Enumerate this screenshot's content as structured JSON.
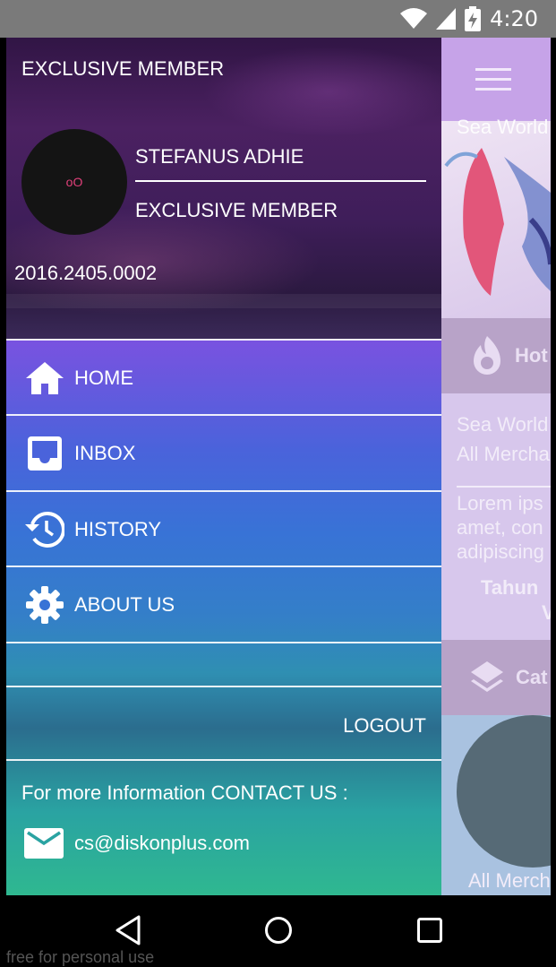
{
  "status_bar": {
    "time": "4:20",
    "icons": [
      "wifi-icon",
      "signal-icon",
      "battery-charging-icon"
    ]
  },
  "background_app": {
    "banner_caption": "Sea World",
    "section_hot": "Hot",
    "card_line1": "Sea World",
    "card_line2": "All Mercha",
    "card_desc1": "Lorem ips",
    "card_desc2": "amet, con",
    "card_desc3": "adipiscing",
    "card_year": "Tahun",
    "card_extra": "V",
    "section_cat": "Cat",
    "footer_text": "All Merch"
  },
  "drawer": {
    "header": {
      "title": "EXCLUSIVE MEMBER",
      "user_name": "STEFANUS ADHIE",
      "user_level": "EXCLUSIVE MEMBER",
      "member_id": "2016.2405.0002",
      "avatar_glyph": "oO"
    },
    "menu": [
      {
        "label": "HOME",
        "icon": "home-icon"
      },
      {
        "label": "INBOX",
        "icon": "inbox-icon"
      },
      {
        "label": "HISTORY",
        "icon": "history-icon"
      },
      {
        "label": "ABOUT US",
        "icon": "gear-icon"
      }
    ],
    "logout_label": "LOGOUT",
    "contact": {
      "title": "For more Information CONTACT US :",
      "email": "cs@diskonplus.com"
    }
  },
  "nav_bar": {
    "buttons": [
      "back-icon",
      "home-circle-icon",
      "recents-icon"
    ]
  },
  "watermark": "free for personal use"
}
